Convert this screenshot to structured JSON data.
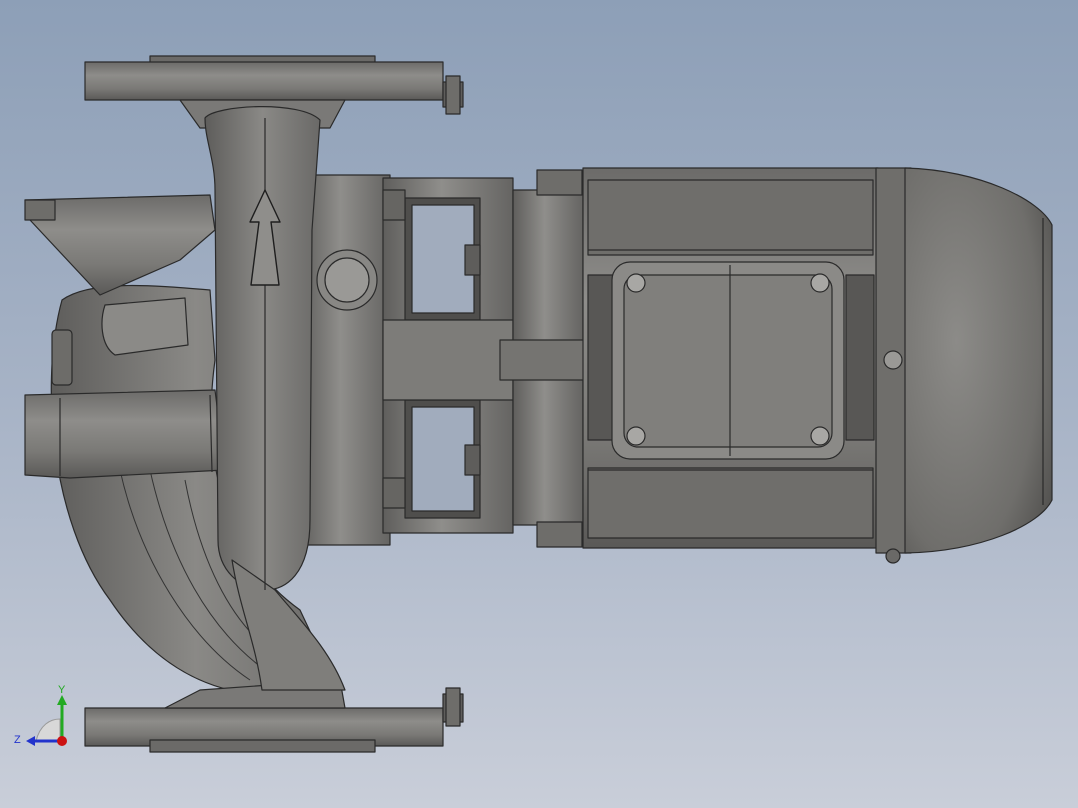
{
  "viewport": {
    "background_top": "#8d9fb7",
    "background_bottom": "#c9ced9"
  },
  "model": {
    "name": "inline-centrifugal-pump-with-motor",
    "body_color": "#7b7a78",
    "edge_color": "#2a2a2a",
    "flow_arrow_icon": "up-arrow-icon"
  },
  "triad": {
    "y_label": "Y",
    "z_label": "Z",
    "y_color": "#22aa22",
    "z_color": "#2233cc",
    "origin_color": "#cc1111"
  }
}
